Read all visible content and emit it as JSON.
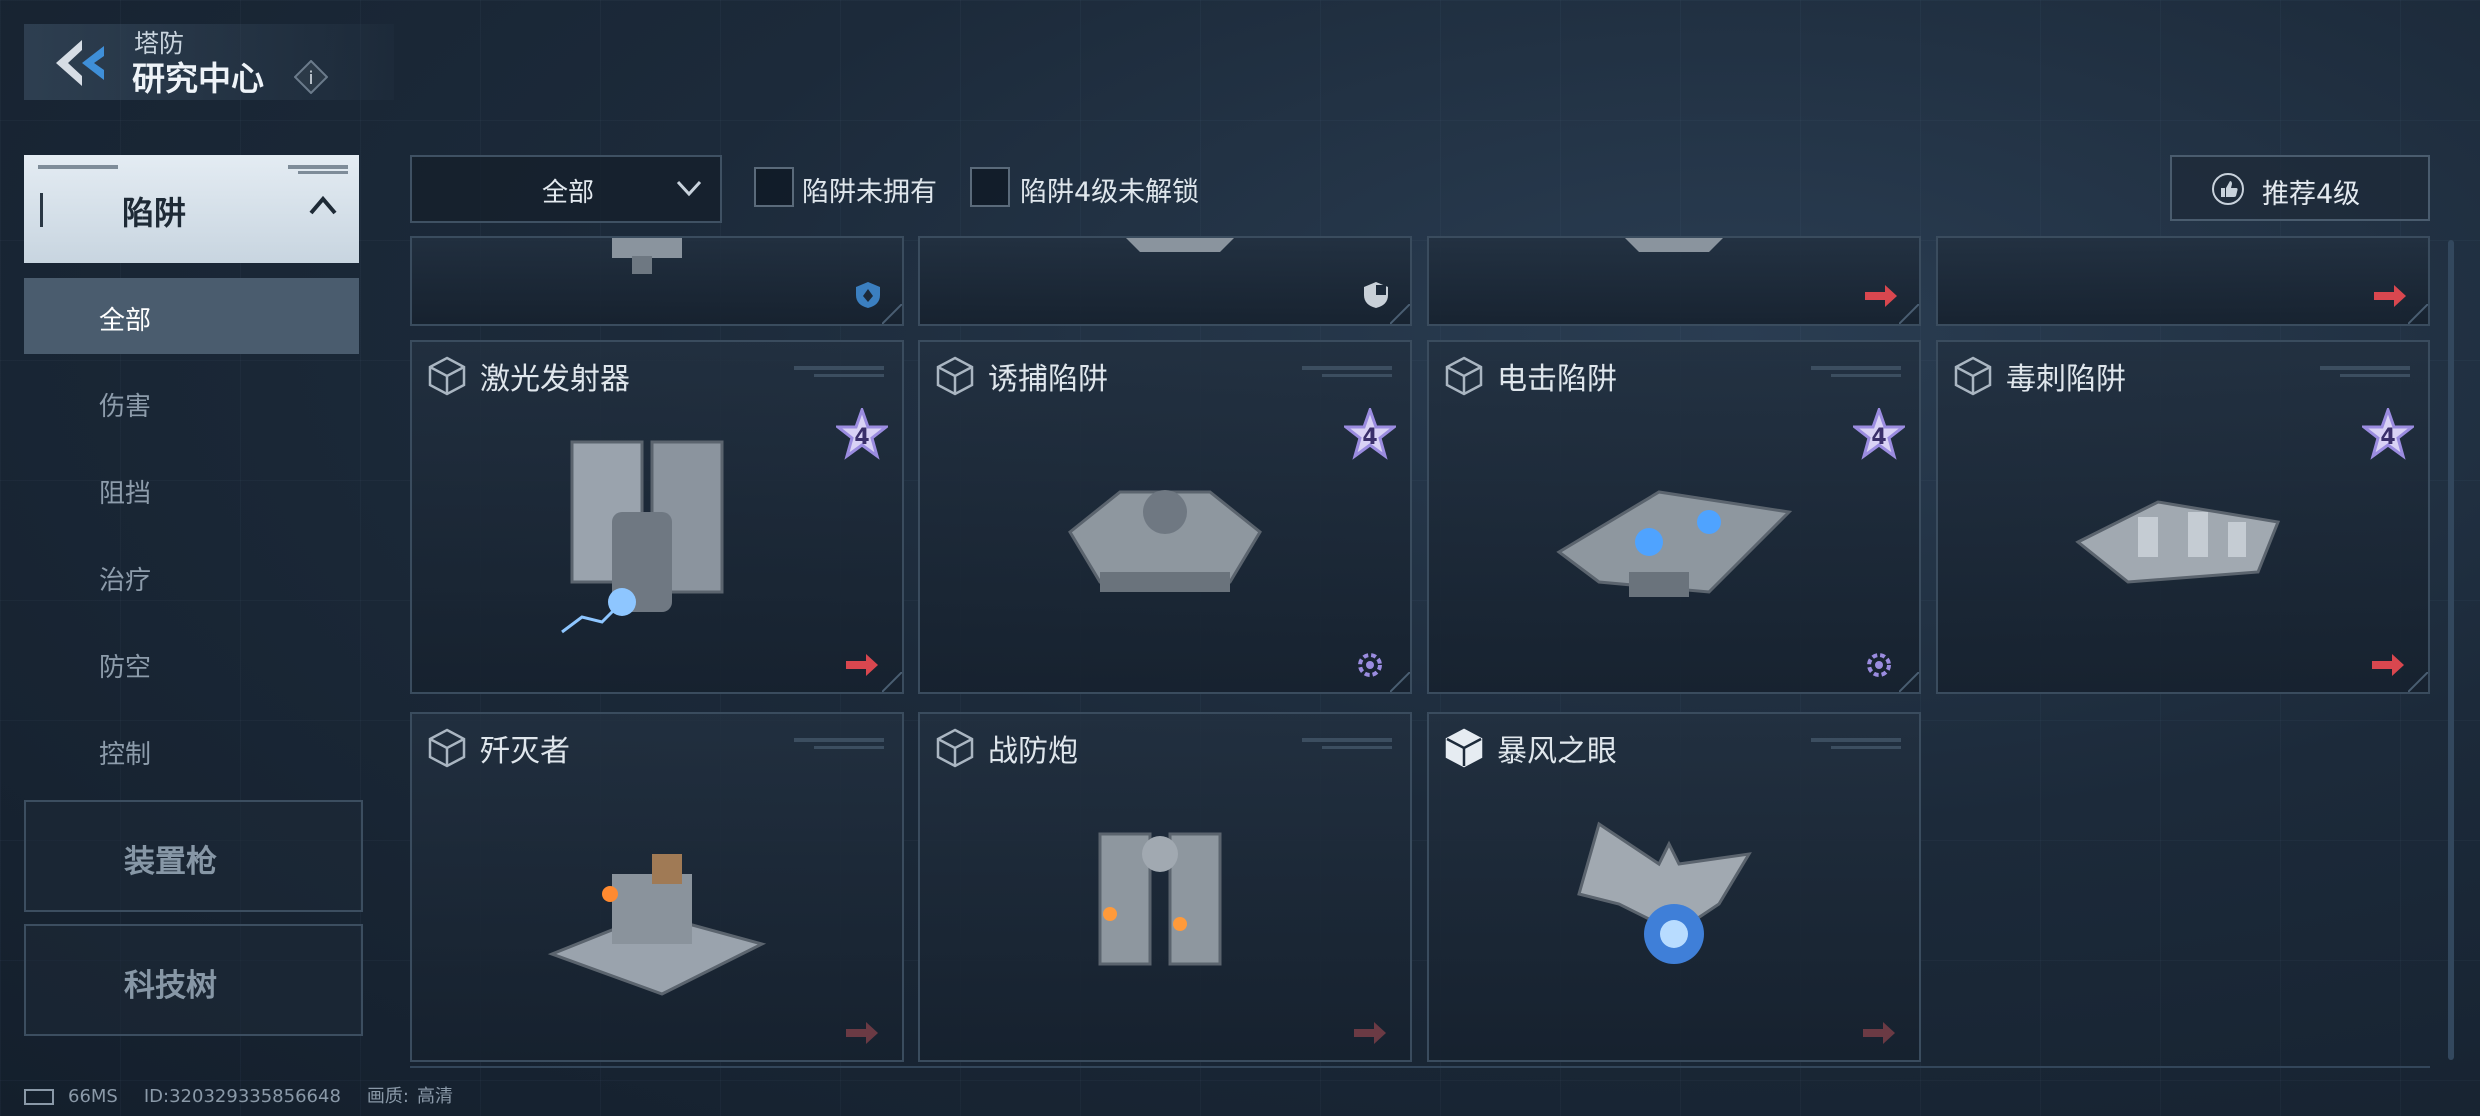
{
  "header": {
    "subtitle": "塔防",
    "title": "研究中心",
    "info_label": "i"
  },
  "sidebar": {
    "main_category": "陷阱",
    "sub_items": [
      "全部",
      "伤害",
      "阻挡",
      "治疗",
      "防空",
      "控制"
    ],
    "other_categories": [
      "装置枪",
      "科技树"
    ]
  },
  "filters": {
    "dropdown_value": "全部",
    "checkbox_1": "陷阱未拥有",
    "checkbox_2": "陷阱4级未解锁",
    "recommend_label": "推荐4级"
  },
  "cards_row2": [
    {
      "name": "激光发射器",
      "star_level": "4",
      "status_icon": "arrow-icon"
    },
    {
      "name": "诱捕陷阱",
      "star_level": "4",
      "status_icon": "gear-icon"
    },
    {
      "name": "电击陷阱",
      "star_level": "4",
      "status_icon": "gear-icon"
    },
    {
      "name": "毒刺陷阱",
      "star_level": "4",
      "status_icon": "arrow-icon"
    }
  ],
  "cards_row3": [
    {
      "name": "歼灭者"
    },
    {
      "name": "战防炮"
    },
    {
      "name": "暴风之眼"
    }
  ],
  "status_bar": {
    "ping": "66MS",
    "id": "ID:320329335856648",
    "quality_label": "画质:",
    "quality_value": "高清"
  },
  "colors": {
    "accent_red": "#d9474f",
    "accent_purple": "#9b8ce0",
    "accent_blue": "#3f8fd8"
  }
}
